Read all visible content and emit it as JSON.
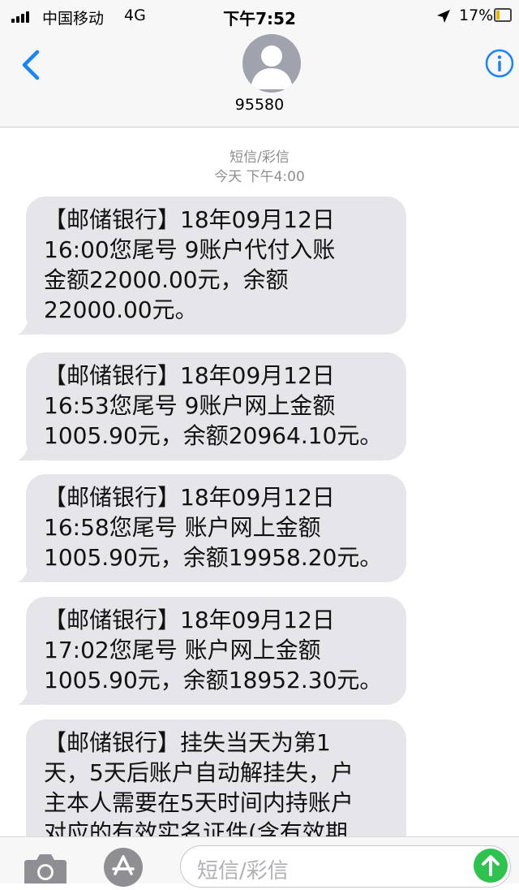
{
  "status_bar": {
    "carrier": "中国移动",
    "network": "4G",
    "time": "下午7:52",
    "battery": "17%",
    "icons": [
      "signal-icon",
      "location-icon",
      "battery-icon"
    ]
  },
  "header": {
    "contact": "95580",
    "icons": [
      "back-chevron-icon",
      "avatar-icon",
      "info-icon"
    ]
  },
  "thread": {
    "service_label": "短信/彩信",
    "timestamp": "今天 下午4:00",
    "messages": [
      {
        "lines": [
          "【邮储银行】18年09月12日",
          "16:00您尾号 9账户代付入账",
          "金额22000.00元，余额",
          "22000.00元。"
        ]
      },
      {
        "lines": [
          "【邮储银行】18年09月12日",
          "16:53您尾号 9账户网上金额",
          "1005.90元，余额20964.10元。"
        ]
      },
      {
        "lines": [
          "【邮储银行】18年09月12日",
          "16:58您尾号 账户网上金额",
          "1005.90元，余额19958.20元。"
        ]
      },
      {
        "lines": [
          "【邮储银行】18年09月12日",
          "17:02您尾号 账户网上金额",
          "1005.90元，余额18952.30元。"
        ]
      },
      {
        "lines": [
          "【邮储银行】挂失当天为第1",
          "天，5天后账户自动解挂失，户",
          "主本人需要在5天时间内持账户",
          "对应的有效实名证件(含有效期"
        ]
      }
    ]
  },
  "input_bar": {
    "placeholder": "短信/彩信",
    "icons": [
      "camera-icon",
      "app-store-icon",
      "send-arrow-icon"
    ]
  },
  "colors": {
    "accent": "#1a82fb",
    "bubble": "#e5e5ea",
    "send": "#2ec24f",
    "meta_text": "#8e8e93"
  }
}
